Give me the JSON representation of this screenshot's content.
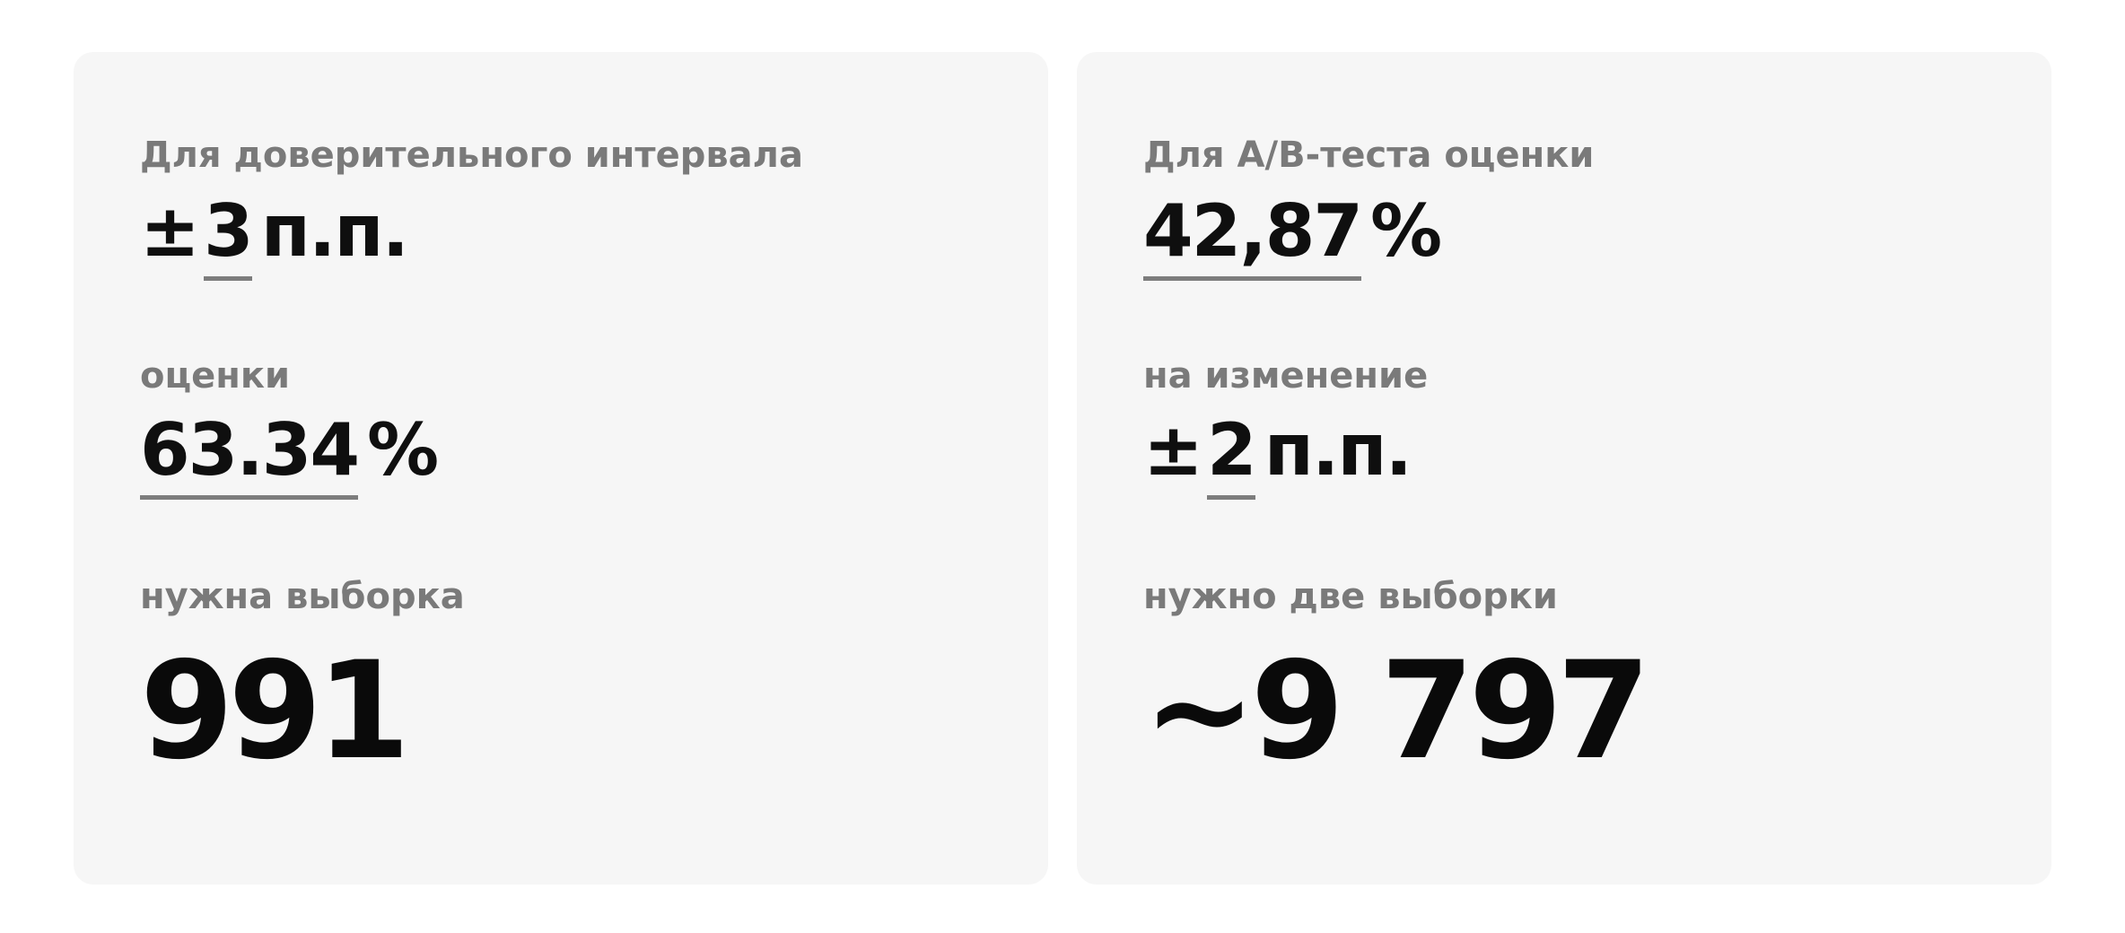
{
  "ci_card": {
    "label_interval": "Для доверительного интервала",
    "interval_sign": "±",
    "interval_value": "3",
    "interval_unit": "п.п.",
    "label_estimate": "оценки",
    "estimate_value": "63.34",
    "estimate_unit": "%",
    "label_sample": "нужна выборка",
    "sample_size": "991"
  },
  "ab_card": {
    "label_estimate": "Для A/B-теста оценки",
    "estimate_value": "42,87",
    "estimate_unit": "%",
    "label_change": "на изменение",
    "change_sign": "±",
    "change_value": "2",
    "change_unit": "п.п.",
    "label_sample": "нужно две выборки",
    "sample_size": "~9 797"
  },
  "colors": {
    "card_background": "#f6f6f6",
    "label_gray": "#7a7a7a",
    "value_black": "#0f0f0f",
    "underline_gray": "#7d7d7d"
  }
}
